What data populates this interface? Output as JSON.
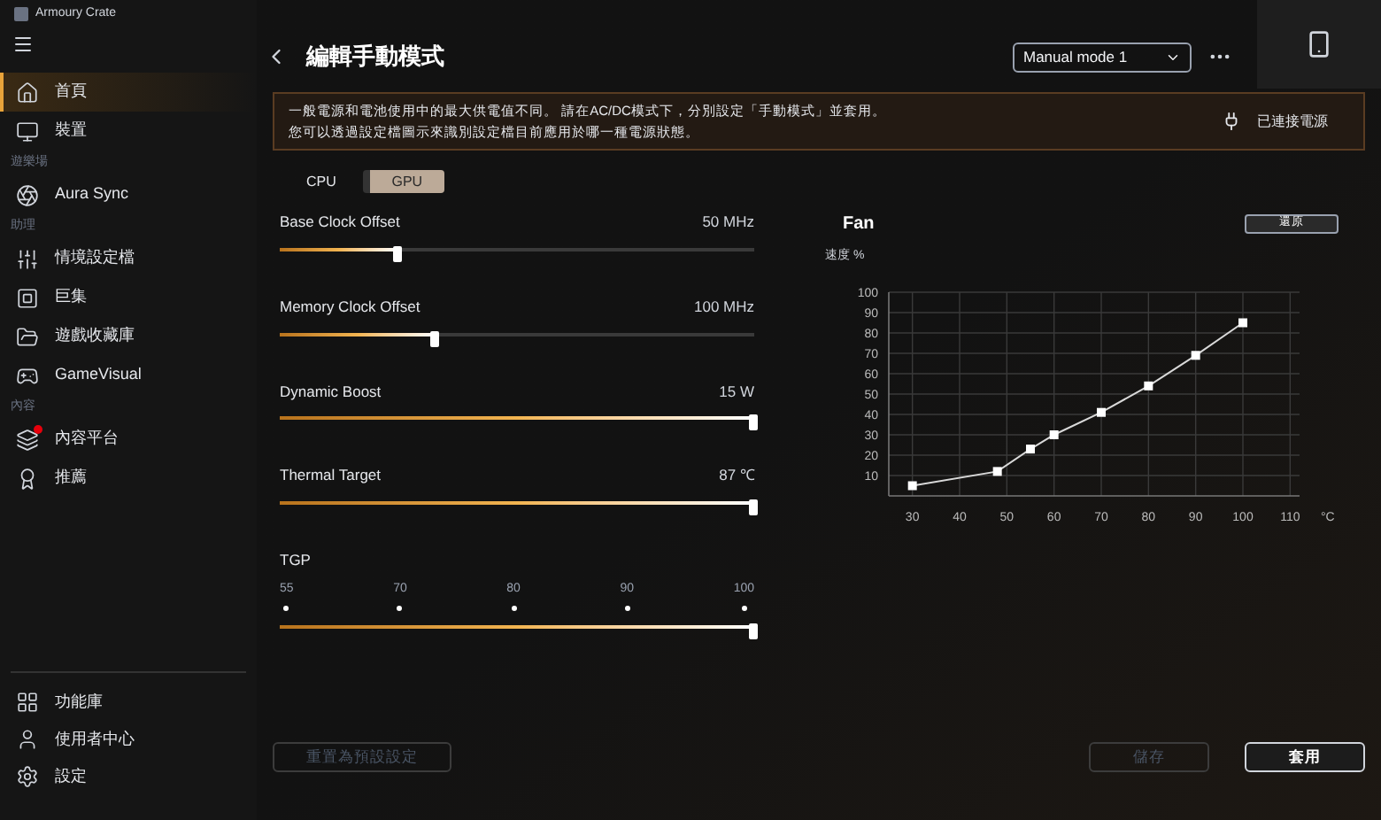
{
  "window": {
    "title": "Armoury Crate"
  },
  "sidebar": {
    "items": [
      {
        "kind": "item",
        "label": "首頁",
        "selected": true,
        "badge": false
      },
      {
        "kind": "item",
        "label": "裝置",
        "selected": false,
        "badge": false
      },
      {
        "kind": "section",
        "label": "遊樂場"
      },
      {
        "kind": "item",
        "label": "Aura Sync",
        "selected": false,
        "badge": false
      },
      {
        "kind": "section",
        "label": "助理"
      },
      {
        "kind": "item",
        "label": "情境設定檔",
        "selected": false,
        "badge": false
      },
      {
        "kind": "item",
        "label": "巨集",
        "selected": false,
        "badge": false
      },
      {
        "kind": "item",
        "label": "遊戲收藏庫",
        "selected": false,
        "badge": false
      },
      {
        "kind": "item",
        "label": "GameVisual",
        "selected": false,
        "badge": false
      },
      {
        "kind": "section",
        "label": "內容"
      },
      {
        "kind": "item",
        "label": "內容平台",
        "selected": false,
        "badge": true
      },
      {
        "kind": "item",
        "label": "推薦",
        "selected": false,
        "badge": false
      }
    ],
    "bottom_items": [
      {
        "label": "功能庫"
      },
      {
        "label": "使用者中心"
      },
      {
        "label": "設定"
      }
    ]
  },
  "header": {
    "title": "編輯手動模式",
    "mode_dropdown": "Manual mode 1"
  },
  "notice": {
    "lines": [
      "一般電源和電池使用中的最大供電值不同。 請在AC/DC模式下，分別設定「手動模式」並套用。",
      "您可以透過設定檔圖示來識別設定檔目前應用於哪一種電源狀態。"
    ],
    "power_status": "已連接電源"
  },
  "tabs": [
    {
      "label": "CPU",
      "selected": false
    },
    {
      "label": "GPU",
      "selected": true
    }
  ],
  "sliders": [
    {
      "kind": "slider",
      "label": "Base Clock Offset",
      "reading": "50 MHz",
      "level": 0.25
    },
    {
      "kind": "slider",
      "label": "Memory Clock Offset",
      "reading": "100 MHz",
      "level": 0.33
    },
    {
      "kind": "slider",
      "label": "Dynamic Boost",
      "reading": "15 W",
      "level": 1
    },
    {
      "kind": "slider",
      "label": "Thermal Target",
      "reading": "87 ℃",
      "level": 1
    },
    {
      "kind": "stepped",
      "label": "TGP",
      "ticks": [
        "55",
        "70",
        "80",
        "90",
        "100"
      ],
      "level": 1
    }
  ],
  "fan": {
    "title": "Fan",
    "reset_button": "還原",
    "chart_data": {
      "type": "line",
      "ylabel": "速度 %",
      "xlabel": "°C",
      "xlim": [
        25,
        112
      ],
      "ylim": [
        0,
        100
      ],
      "xticks": [
        30,
        40,
        50,
        60,
        70,
        80,
        90,
        100,
        110
      ],
      "yticks": [
        10,
        20,
        30,
        40,
        50,
        60,
        70,
        80,
        90,
        100
      ],
      "grid": true,
      "x": [
        30,
        48,
        55,
        60,
        70,
        80,
        90,
        100
      ],
      "series": [
        {
          "color": "#d9d9d9",
          "marker": "square",
          "values": [
            5,
            12,
            23,
            30,
            41,
            54,
            69,
            85
          ]
        }
      ]
    }
  },
  "buttons": [
    {
      "label": "重置為預設設定",
      "disabled": true
    },
    {
      "label": "儲存",
      "disabled": true
    },
    {
      "label": "套用",
      "disabled": false
    }
  ]
}
